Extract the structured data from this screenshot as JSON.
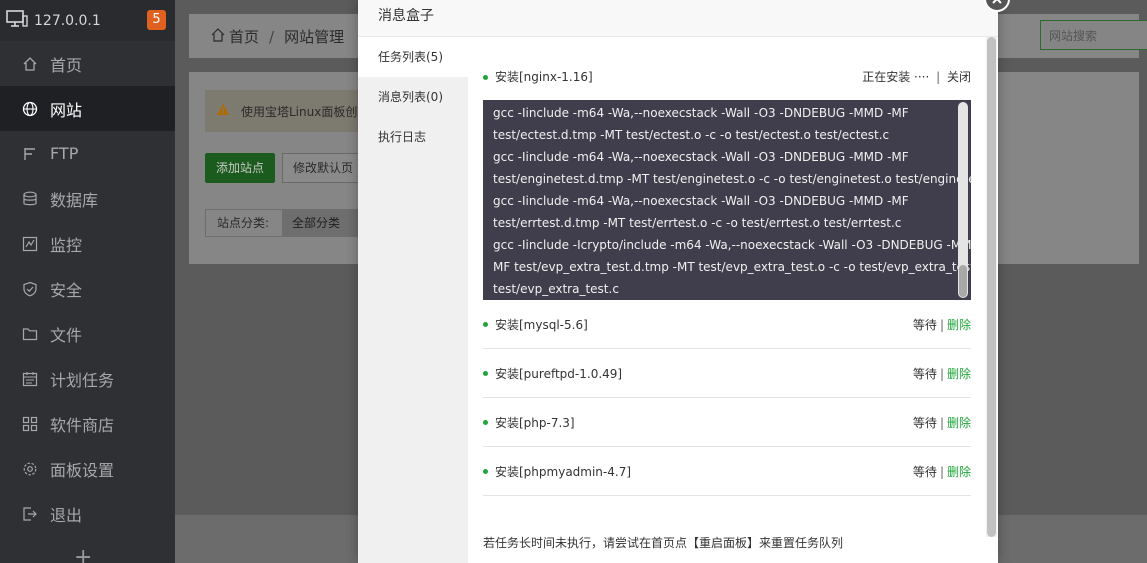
{
  "sidebar": {
    "host": "127.0.0.1",
    "badge": "5",
    "items": [
      {
        "label": "首页",
        "icon": "home-icon"
      },
      {
        "label": "网站",
        "icon": "globe-icon"
      },
      {
        "label": "FTP",
        "icon": "ftp-icon"
      },
      {
        "label": "数据库",
        "icon": "database-icon"
      },
      {
        "label": "监控",
        "icon": "monitor-icon"
      },
      {
        "label": "安全",
        "icon": "shield-icon"
      },
      {
        "label": "文件",
        "icon": "folder-icon"
      },
      {
        "label": "计划任务",
        "icon": "calendar-icon"
      },
      {
        "label": "软件商店",
        "icon": "grid-icon"
      },
      {
        "label": "面板设置",
        "icon": "gear-icon"
      },
      {
        "label": "退出",
        "icon": "logout-icon"
      }
    ],
    "active_item": "网站",
    "plus": "+"
  },
  "main": {
    "breadcrumb": {
      "home": "首页",
      "sep": "/",
      "current": "网站管理"
    },
    "search_placeholder": "网站搜索",
    "notice": "使用宝塔Linux面板创建",
    "add_site": "添加站点",
    "modify_default": "修改默认页",
    "category_label": "站点分类:",
    "category_value": "全部分类"
  },
  "modal": {
    "title": "消息盒子",
    "tabs": [
      "任务列表(5)",
      "消息列表(0)",
      "执行日志"
    ],
    "active_tab": "任务列表(5)",
    "current_task": {
      "name": "安装[nginx-1.16]",
      "status": "正在安装 ····",
      "close": "关闭"
    },
    "log_lines": [
      "gcc -Iinclude -m64 -Wa,--noexecstack -Wall -O3 -DNDEBUG -MMD -MF",
      "test/ectest.d.tmp -MT test/ectest.o -c -o test/ectest.o test/ectest.c",
      "gcc -Iinclude -m64 -Wa,--noexecstack -Wall -O3 -DNDEBUG -MMD -MF",
      "test/enginetest.d.tmp -MT test/enginetest.o -c -o test/enginetest.o test/enginetest.c",
      "gcc -Iinclude -m64 -Wa,--noexecstack -Wall -O3 -DNDEBUG -MMD -MF",
      "test/errtest.d.tmp -MT test/errtest.o -c -o test/errtest.o test/errtest.c",
      "gcc -Iinclude -Icrypto/include -m64 -Wa,--noexecstack -Wall -O3 -DNDEBUG -MMD -",
      "MF test/evp_extra_test.d.tmp -MT test/evp_extra_test.o -c -o test/evp_extra_test.o",
      "test/evp_extra_test.c"
    ],
    "queued": [
      {
        "name": "安装[mysql-5.6]",
        "status": "等待",
        "action": "删除"
      },
      {
        "name": "安装[pureftpd-1.0.49]",
        "status": "等待",
        "action": "删除"
      },
      {
        "name": "安装[php-7.3]",
        "status": "等待",
        "action": "删除"
      },
      {
        "name": "安装[phpmyadmin-4.7]",
        "status": "等待",
        "action": "删除"
      }
    ],
    "note": "若任务长时间未执行，请尝试在首页点【重启面板】来重置任务队列",
    "pipe": "|"
  },
  "colors": {
    "accent": "#20a53a",
    "badge": "#e0611f",
    "sidebar": "#2f3034",
    "log_bg": "#403e4c"
  }
}
